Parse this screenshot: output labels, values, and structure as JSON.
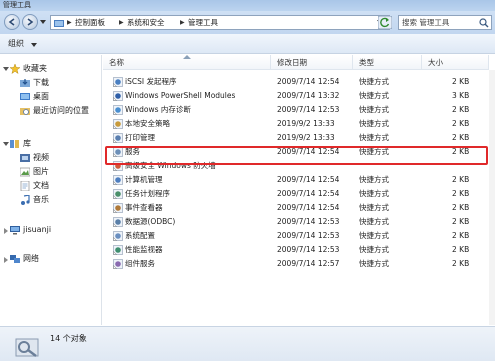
{
  "window": {
    "title": "管理工具"
  },
  "address": {
    "crumbs": [
      "控制面板",
      "系统和安全",
      "管理工具"
    ]
  },
  "search": {
    "placeholder": "搜索 管理工具"
  },
  "toolbar": {
    "organize_label": "组织"
  },
  "nav": {
    "favorites": {
      "label": "收藏夹",
      "items": [
        "下载",
        "桌面",
        "最近访问的位置"
      ]
    },
    "libraries": {
      "label": "库",
      "items": [
        "视频",
        "图片",
        "文档",
        "音乐"
      ]
    },
    "computer": {
      "label": "jisuanji"
    },
    "network": {
      "label": "网络"
    }
  },
  "columns": {
    "name": "名称",
    "modified": "修改日期",
    "type": "类型",
    "size": "大小"
  },
  "files": [
    {
      "name": "iSCSI 发起程序",
      "modified": "2009/7/14 12:54",
      "type": "快捷方式",
      "size": "2 KB",
      "icon": "iscsi-icon"
    },
    {
      "name": "Windows PowerShell Modules",
      "modified": "2009/7/14 13:32",
      "type": "快捷方式",
      "size": "3 KB",
      "icon": "powershell-icon"
    },
    {
      "name": "Windows 内存诊断",
      "modified": "2009/7/14 12:53",
      "type": "快捷方式",
      "size": "2 KB",
      "icon": "memory-diagnostic-icon"
    },
    {
      "name": "本地安全策略",
      "modified": "2019/9/2 13:33",
      "type": "快捷方式",
      "size": "2 KB",
      "icon": "security-policy-icon"
    },
    {
      "name": "打印管理",
      "modified": "2019/9/2 13:33",
      "type": "快捷方式",
      "size": "2 KB",
      "icon": "print-management-icon"
    },
    {
      "name": "服务",
      "modified": "2009/7/14 12:54",
      "type": "快捷方式",
      "size": "2 KB",
      "icon": "services-icon"
    },
    {
      "name": "高级安全 Windows 防火墙",
      "modified": "",
      "type": "",
      "size": "",
      "icon": "firewall-icon"
    },
    {
      "name": "计算机管理",
      "modified": "2009/7/14 12:54",
      "type": "快捷方式",
      "size": "2 KB",
      "icon": "computer-management-icon"
    },
    {
      "name": "任务计划程序",
      "modified": "2009/7/14 12:54",
      "type": "快捷方式",
      "size": "2 KB",
      "icon": "task-scheduler-icon"
    },
    {
      "name": "事件查看器",
      "modified": "2009/7/14 12:54",
      "type": "快捷方式",
      "size": "2 KB",
      "icon": "event-viewer-icon"
    },
    {
      "name": "数据源(ODBC)",
      "modified": "2009/7/14 12:53",
      "type": "快捷方式",
      "size": "2 KB",
      "icon": "odbc-icon"
    },
    {
      "name": "系统配置",
      "modified": "2009/7/14 12:53",
      "type": "快捷方式",
      "size": "2 KB",
      "icon": "system-config-icon"
    },
    {
      "name": "性能监视器",
      "modified": "2009/7/14 12:53",
      "type": "快捷方式",
      "size": "2 KB",
      "icon": "performance-monitor-icon"
    },
    {
      "name": "组件服务",
      "modified": "2009/7/14 12:57",
      "type": "快捷方式",
      "size": "2 KB",
      "icon": "component-services-icon"
    }
  ],
  "status": {
    "count": "14 个对象"
  },
  "colors": {
    "highlight": "#e0292a",
    "titlebar": "#a9c6e8"
  }
}
